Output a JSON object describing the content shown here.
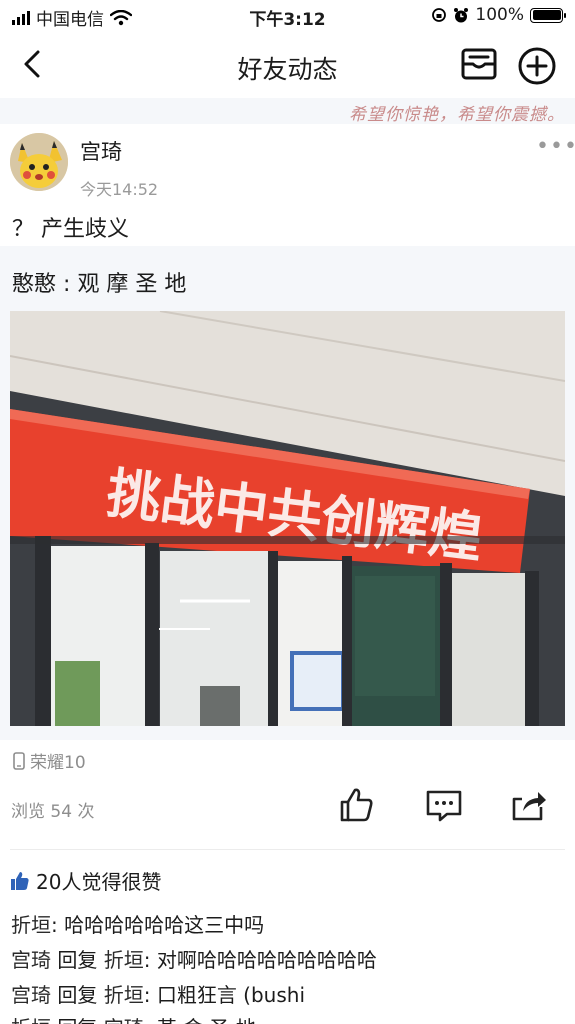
{
  "status_bar": {
    "carrier": "中国电信",
    "time": "下午3:12",
    "battery": "100%"
  },
  "nav": {
    "title": "好友动态"
  },
  "banner": {
    "slogan": "希望你惊艳，希望你震撼。"
  },
  "post": {
    "author": "宫琦",
    "time": "今天14:52",
    "caption": "？ 产生歧义",
    "quoted": {
      "author": "憨憨",
      "separator": ":",
      "text": "观 摩 圣 地",
      "photo_banner_text": "挑战中共创辉煌"
    },
    "device": "荣耀10",
    "views": "浏览 54 次"
  },
  "likes": {
    "text": "20人觉得很赞"
  },
  "comments": [
    {
      "author": "折垣",
      "reply_to": "",
      "text": "哈哈哈哈哈哈这三中吗"
    },
    {
      "author": "宫琦",
      "reply_word": "回复",
      "reply_to": "折垣",
      "text": "对啊哈哈哈哈哈哈哈哈哈"
    },
    {
      "author": "宫琦",
      "reply_word": "回复",
      "reply_to": "折垣",
      "text": "口粗狂言 (bushi"
    },
    {
      "author": "折垣",
      "reply_word": "回复",
      "reply_to": "宫琦",
      "text": "革 命 圣 地"
    }
  ],
  "colors": {
    "accent": "#1c1c1c",
    "muted": "#8d8d8d",
    "banner_red": "#e8412d"
  }
}
